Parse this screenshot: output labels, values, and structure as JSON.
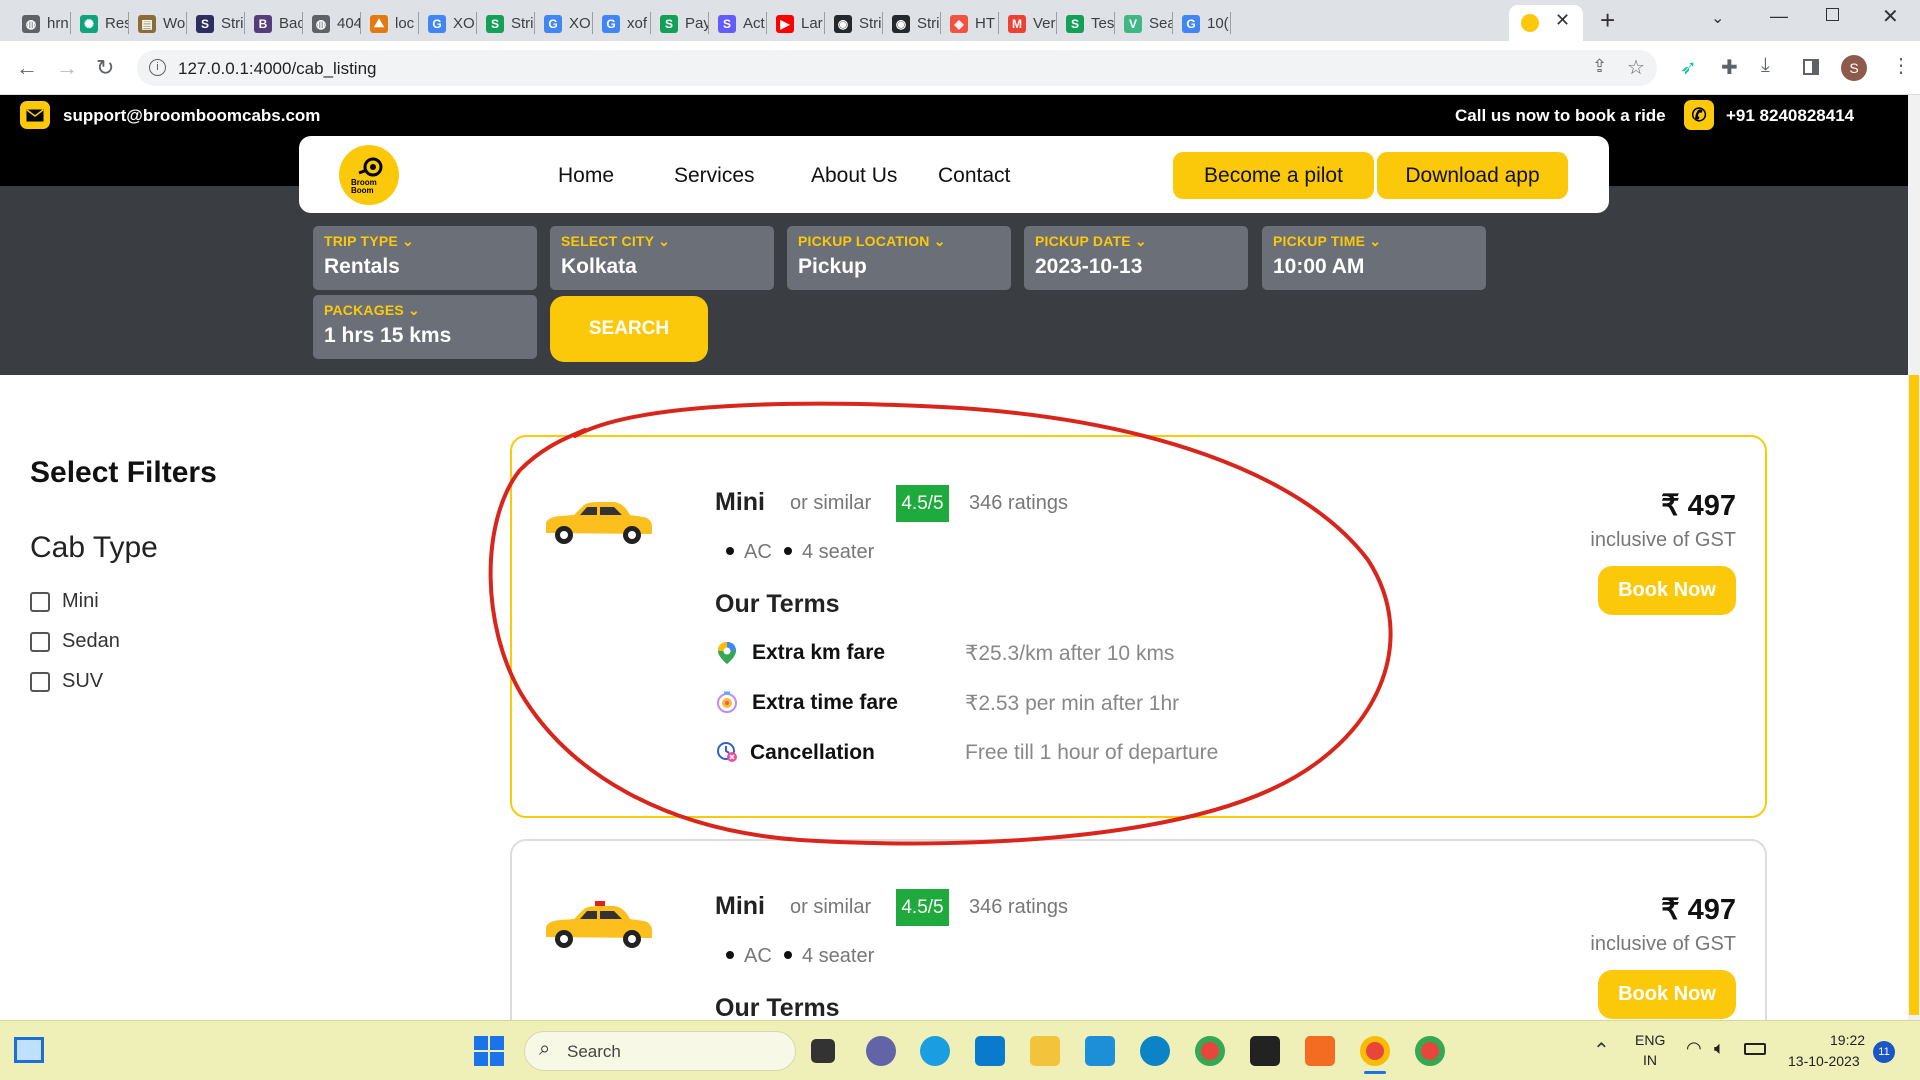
{
  "browser": {
    "tabs": [
      {
        "title": "hrn",
        "icon": "globe-icon"
      },
      {
        "title": "Res",
        "icon": "openai-icon"
      },
      {
        "title": "Wo",
        "icon": "page-icon"
      },
      {
        "title": "Stri",
        "icon": "s-icon"
      },
      {
        "title": "Bac",
        "icon": "bootstrap-icon"
      },
      {
        "title": "404",
        "icon": "globe-icon"
      },
      {
        "title": "loc",
        "icon": "pma-icon"
      },
      {
        "title": "XO",
        "icon": "google-icon"
      },
      {
        "title": "Stri",
        "icon": "s-green-icon"
      },
      {
        "title": "XO",
        "icon": "google-icon"
      },
      {
        "title": "xof",
        "icon": "google-icon"
      },
      {
        "title": "Pay",
        "icon": "s-green-icon"
      },
      {
        "title": "Act",
        "icon": "s-purple-icon"
      },
      {
        "title": "Lar",
        "icon": "youtube-icon"
      },
      {
        "title": "Stri",
        "icon": "github-icon"
      },
      {
        "title": "Stri",
        "icon": "github-icon"
      },
      {
        "title": "HT",
        "icon": "laravel-icon"
      },
      {
        "title": "Ver",
        "icon": "gmail-icon"
      },
      {
        "title": "Tes",
        "icon": "s-green-icon"
      },
      {
        "title": "Sea",
        "icon": "vue-icon"
      },
      {
        "title": "10(",
        "icon": "google-icon"
      }
    ],
    "new_tab": "+",
    "url": "127.0.0.1:4000/cab_listing",
    "profile_initial": "S"
  },
  "site": {
    "support_email": "support@broomboomcabs.com",
    "call_text": "Call us now to book a ride",
    "phone": "+91 8240828414",
    "logo_text": "Broom Boom",
    "nav": [
      "Home",
      "Services",
      "About Us",
      "Contact"
    ],
    "become_pilot": "Become a pilot",
    "download_app": "Download app"
  },
  "search": {
    "fields": [
      {
        "label": "TRIP TYPE",
        "value": "Rentals"
      },
      {
        "label": "SELECT CITY",
        "value": "Kolkata"
      },
      {
        "label": "PICKUP LOCATION",
        "value": "Pickup"
      },
      {
        "label": "PICKUP DATE",
        "value": "2023-10-13"
      },
      {
        "label": "PICKUP TIME",
        "value": "10:00 AM"
      },
      {
        "label": "PACKAGES",
        "value": "1 hrs 15 kms"
      }
    ],
    "button": "SEARCH"
  },
  "filters": {
    "title": "Select Filters",
    "cab_type_heading": "Cab Type",
    "options": [
      "Mini",
      "Sedan",
      "SUV"
    ]
  },
  "listings": [
    {
      "name": "Mini",
      "similar": "or similar",
      "rating": "4.5/5",
      "ratings_count": "346 ratings",
      "features": [
        "AC",
        "4 seater"
      ],
      "price": "₹ 497",
      "price_note": "inclusive of GST",
      "book": "Book Now",
      "terms_title": "Our Terms",
      "terms": [
        {
          "label": "Extra km fare",
          "value": "₹25.3/km after 10 kms",
          "icon": "map-pin-icon"
        },
        {
          "label": "Extra time fare",
          "value": "₹2.53 per min after 1hr",
          "icon": "timer-icon"
        },
        {
          "label": "Cancellation",
          "value": "Free till 1 hour of departure",
          "icon": "cancel-clock-icon"
        }
      ]
    },
    {
      "name": "Mini",
      "similar": "or similar",
      "rating": "4.5/5",
      "ratings_count": "346 ratings",
      "features": [
        "AC",
        "4 seater"
      ],
      "price": "₹ 497",
      "price_note": "inclusive of GST",
      "book": "Book Now",
      "terms_title": "Our Terms"
    }
  ],
  "taskbar": {
    "search": "Search",
    "lang": "ENG",
    "region": "IN",
    "time": "19:22",
    "date": "13-10-2023",
    "notif_count": "11"
  },
  "colors": {
    "accent": "#fcc90a",
    "rating_bg": "#1faa3e",
    "annotation": "#d9261c"
  }
}
